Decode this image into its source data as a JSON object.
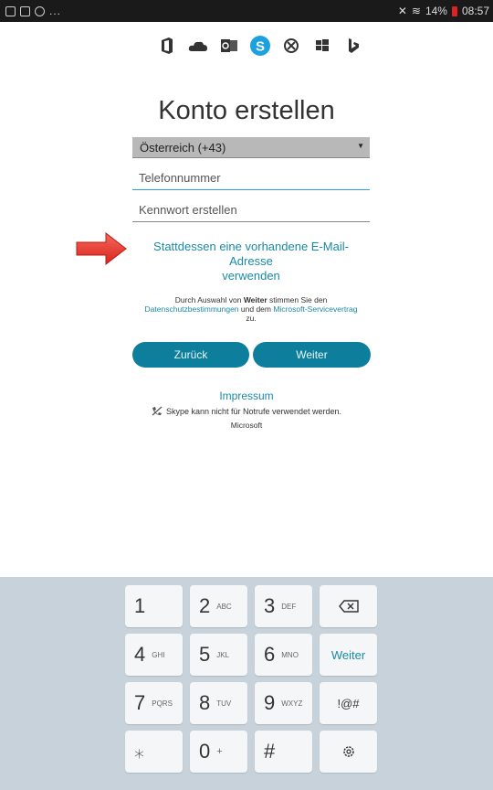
{
  "status_bar": {
    "battery": "14%",
    "time": "08:57",
    "dots": "..."
  },
  "products": [
    {
      "icon": "office-icon"
    },
    {
      "icon": "onedrive-icon"
    },
    {
      "icon": "outlook-icon"
    },
    {
      "icon": "skype-icon",
      "active": true
    },
    {
      "icon": "xbox-icon"
    },
    {
      "icon": "windows-icon"
    },
    {
      "icon": "bing-icon"
    }
  ],
  "title": "Konto erstellen",
  "country": {
    "selected": "Österreich (+43)"
  },
  "phone_field": {
    "placeholder": "Telefonnummer"
  },
  "password_field": {
    "placeholder": "Kennwort erstellen"
  },
  "alt_email_link": {
    "line1": "Stattdessen eine vorhandene E-Mail-Adresse",
    "line2": "verwenden"
  },
  "terms": {
    "prefix": "Durch Auswahl von ",
    "bold": "Weiter",
    "middle": " stimmen Sie den",
    "privacy_link": "Datenschutzbestimmungen",
    "and": " und dem ",
    "service_link": "Microsoft-Servicevertrag",
    "suffix": "zu."
  },
  "buttons": {
    "back": "Zurück",
    "next": "Weiter"
  },
  "impressum": "Impressum",
  "notice": "Skype kann nicht für Notrufe verwendet werden.",
  "microsoft": "Microsoft",
  "keyboard": {
    "rows": [
      [
        {
          "main": "1",
          "sub": ""
        },
        {
          "main": "2",
          "sub": "ABC"
        },
        {
          "main": "3",
          "sub": "DEF"
        },
        {
          "main": "",
          "sub": "",
          "icon": "backspace-icon"
        }
      ],
      [
        {
          "main": "4",
          "sub": "GHI"
        },
        {
          "main": "5",
          "sub": "JKL"
        },
        {
          "main": "6",
          "sub": "MNO"
        },
        {
          "main": "Weiter",
          "sub": "",
          "accent": true
        }
      ],
      [
        {
          "main": "7",
          "sub": "PQRS"
        },
        {
          "main": "8",
          "sub": "TUV"
        },
        {
          "main": "9",
          "sub": "WXYZ"
        },
        {
          "main": "!@#",
          "sub": ""
        }
      ],
      [
        {
          "main": "⁎",
          "sub": ""
        },
        {
          "main": "0",
          "sub": "+"
        },
        {
          "main": "#",
          "sub": ""
        },
        {
          "main": "",
          "sub": "",
          "icon": "settings-icon"
        }
      ]
    ]
  },
  "colors": {
    "accent": "#0d7f9c",
    "link": "#1a8aa6",
    "skype": "#1ba1e2",
    "arrow": "#e8332a"
  }
}
